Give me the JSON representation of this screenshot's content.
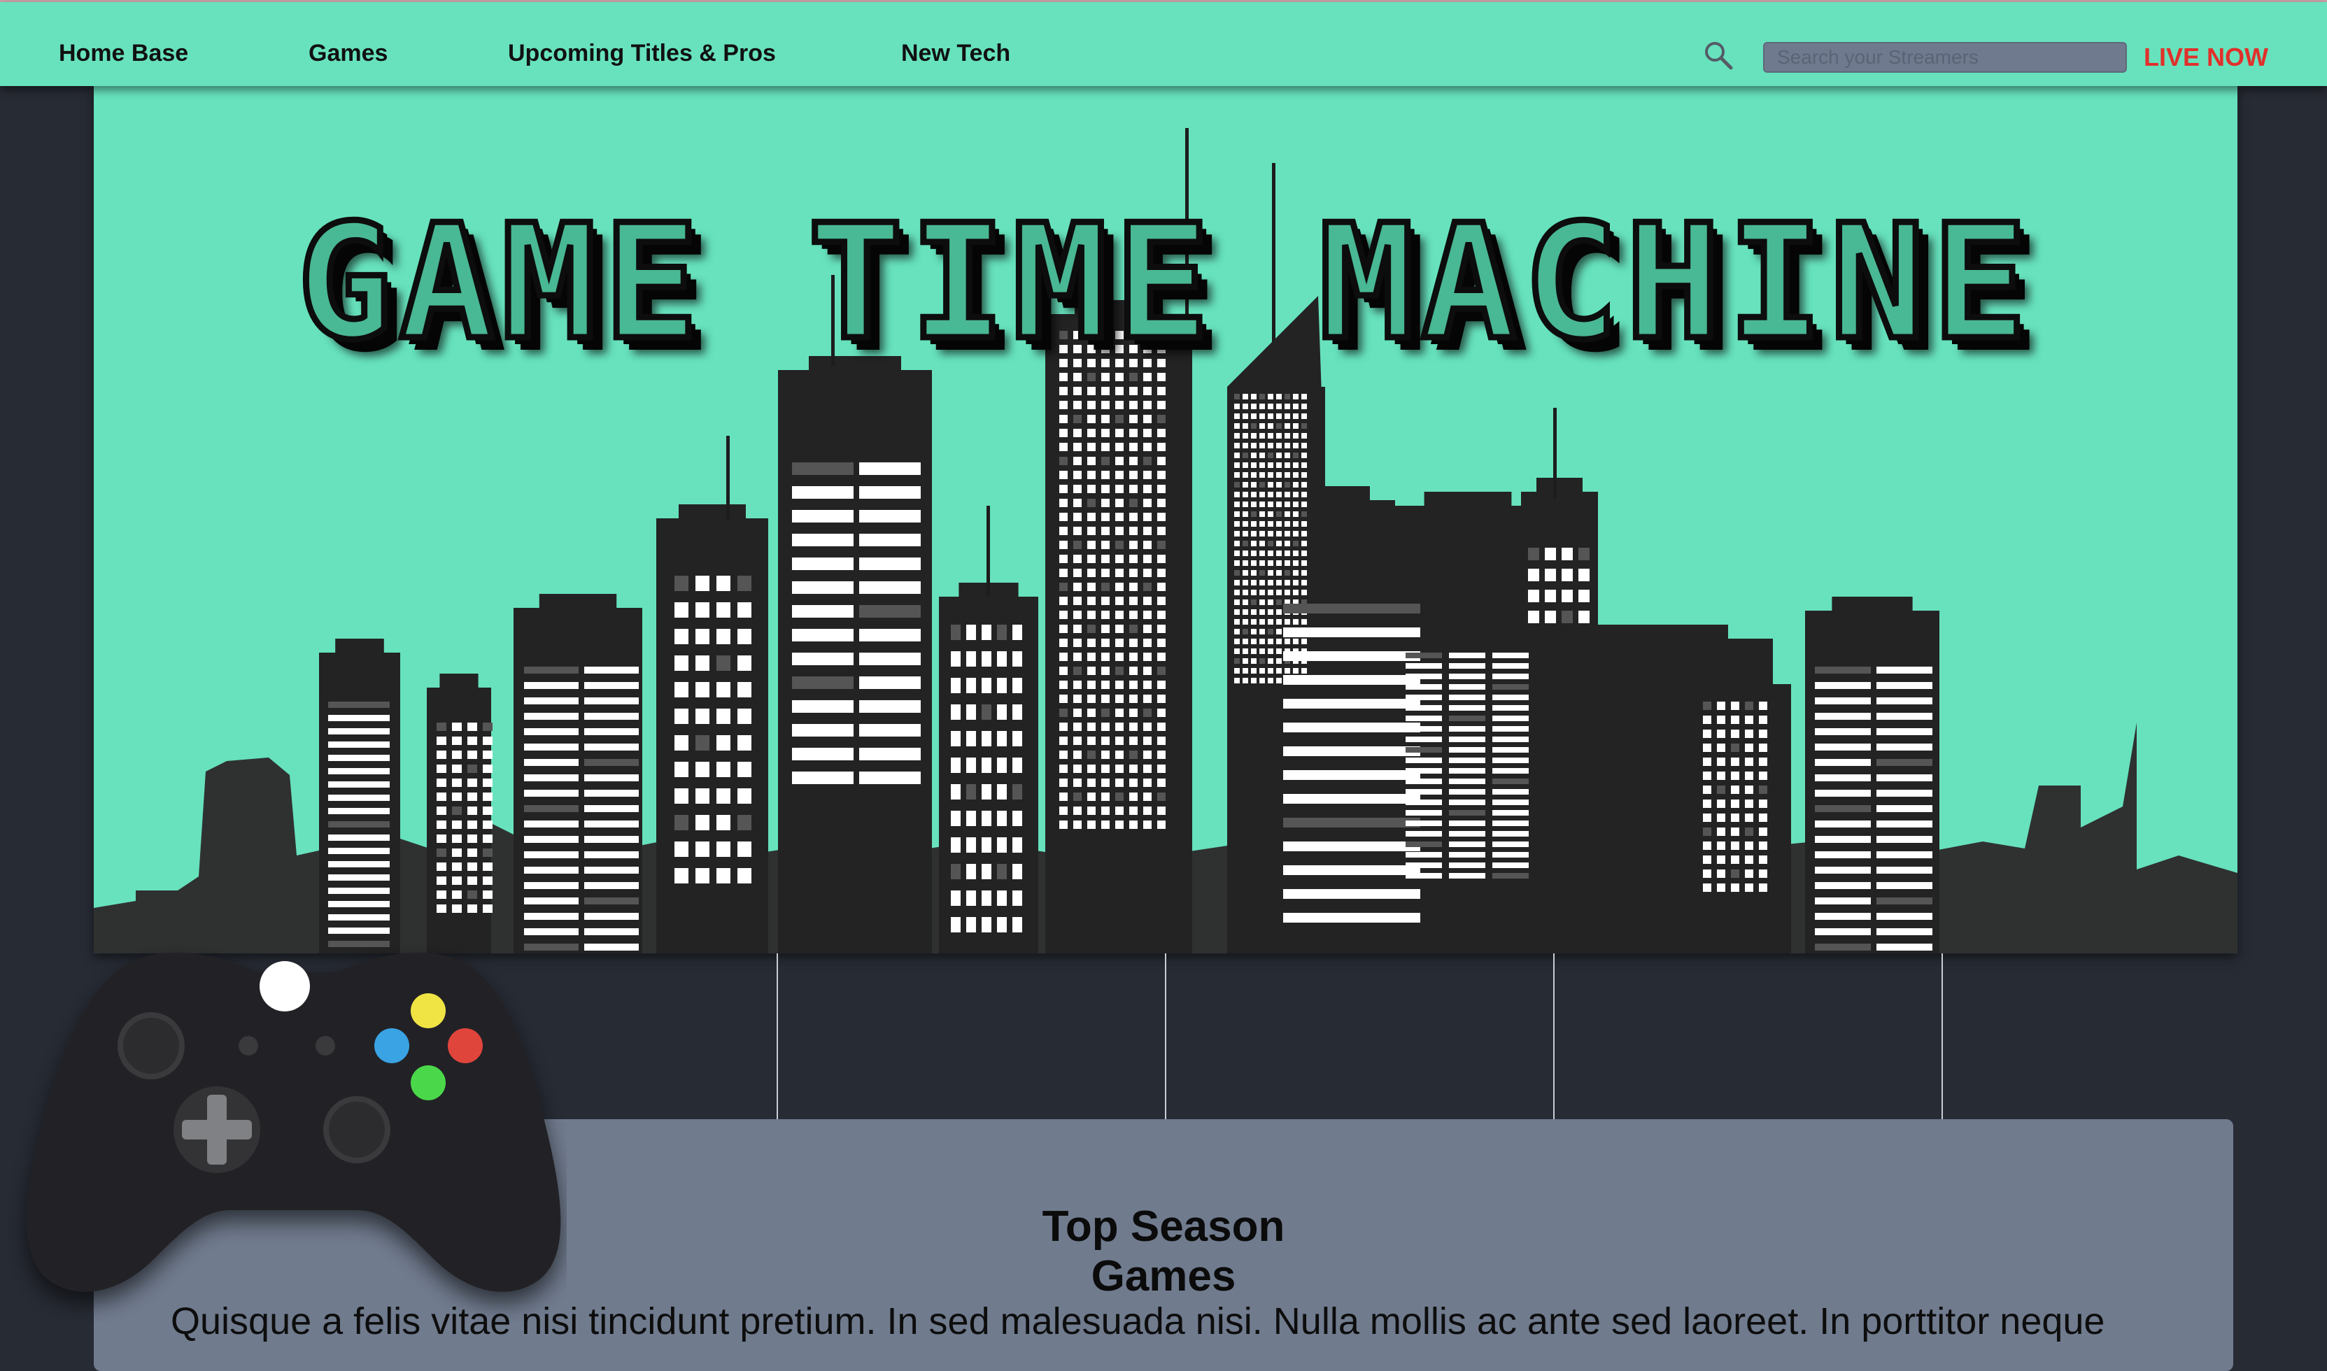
{
  "nav": {
    "items": [
      {
        "label": "Home Base"
      },
      {
        "label": "Games"
      },
      {
        "label": "Upcoming Titles & Pros"
      },
      {
        "label": "New Tech"
      }
    ],
    "search": {
      "placeholder": "Search your Streamers",
      "value": ""
    },
    "live_label": "LIVE NOW"
  },
  "banner": {
    "title": "GAME TIME MACHINE"
  },
  "section": {
    "title": "Top Season Games",
    "text": "Quisque a felis vitae nisi tincidunt pretium. In sed malesuada nisi. Nulla mollis ac ante sed laoreet. In porttitor neque"
  },
  "colors": {
    "nav_bg": "#67e2bd",
    "page_bg": "#272b34",
    "panel_bg": "#707b8e",
    "live_red": "#e1302b",
    "title_fill": "#49b894"
  },
  "icons": {
    "search": "search-icon",
    "controller": "game-controller-icon"
  }
}
